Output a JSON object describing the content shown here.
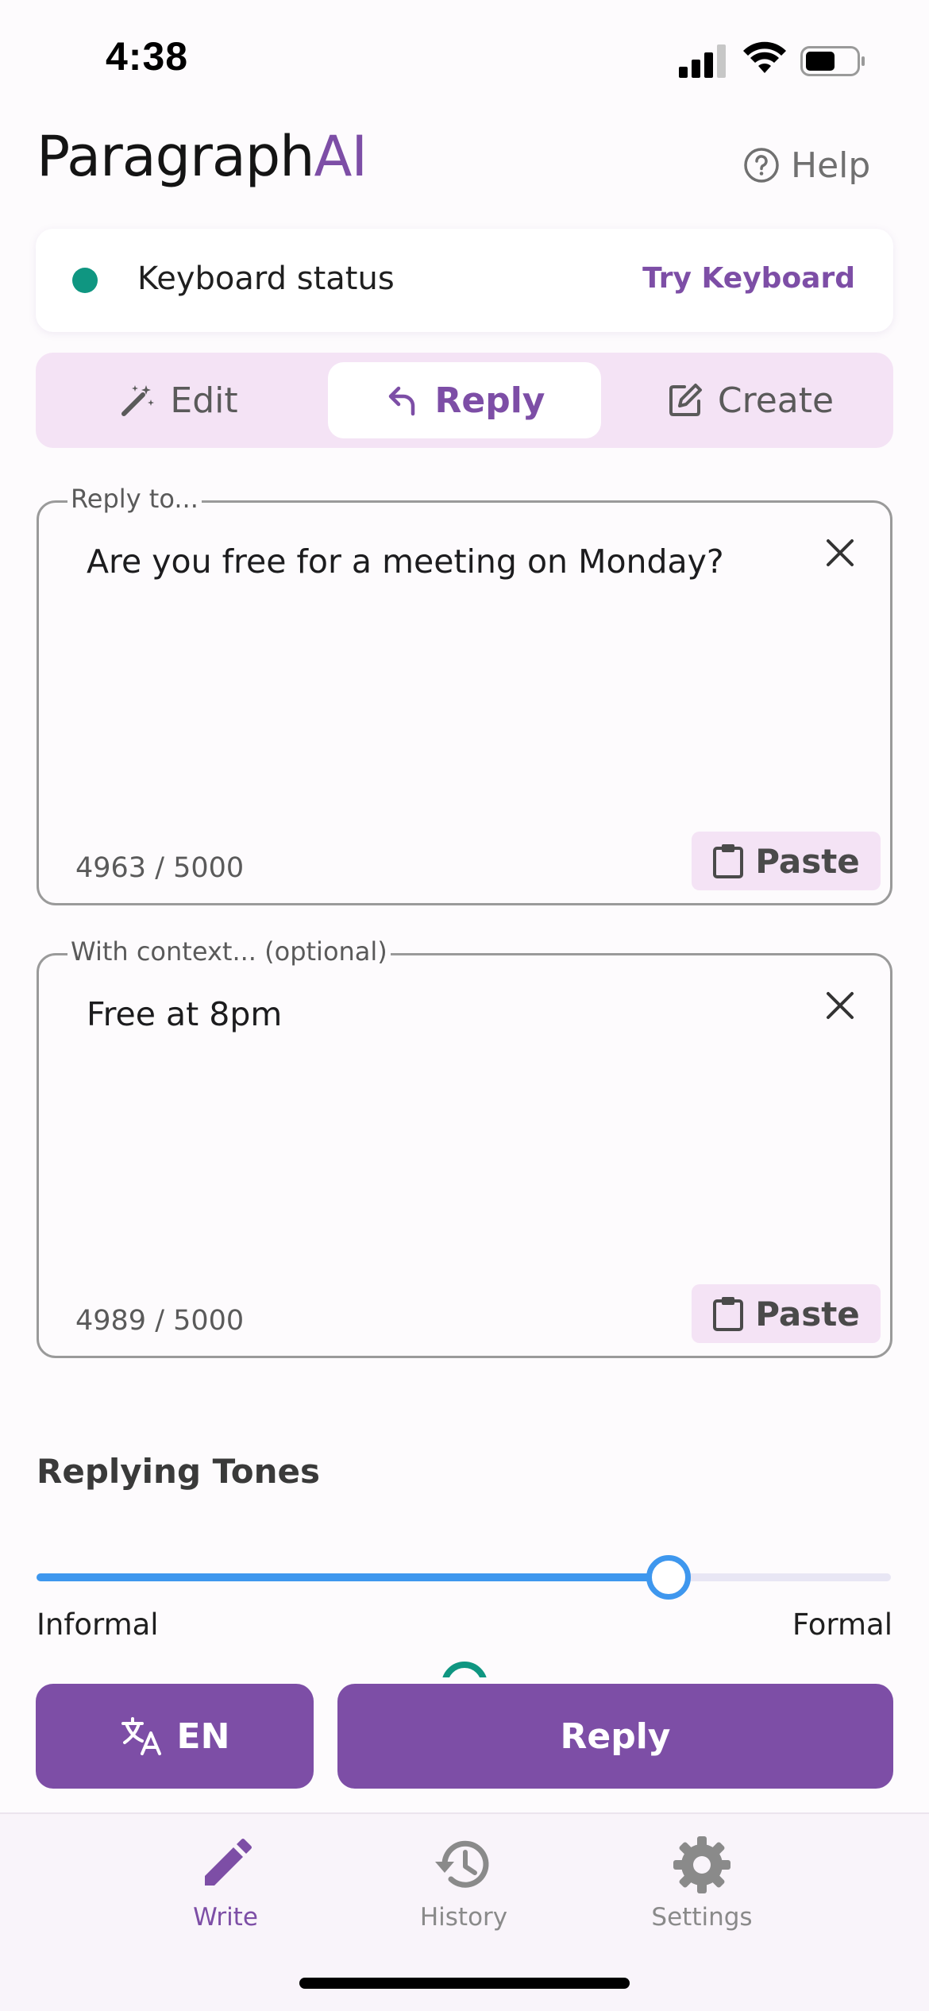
{
  "status_bar": {
    "time": "4:38"
  },
  "header": {
    "logo_main": "Paragraph",
    "logo_accent": "AI",
    "help_label": "Help"
  },
  "keyboard_status": {
    "label": "Keyboard status",
    "action": "Try Keyboard",
    "status_color": "#0f9681"
  },
  "mode_tabs": [
    {
      "label": "Edit",
      "icon": "magic-wand-icon"
    },
    {
      "label": "Reply",
      "icon": "reply-arrow-icon",
      "selected": true
    },
    {
      "label": "Create",
      "icon": "edit-square-icon"
    }
  ],
  "reply_field": {
    "legend": "Reply to...",
    "value": "Are you free for a meeting on Monday?",
    "counter": "4963 / 5000",
    "paste_label": "Paste"
  },
  "context_field": {
    "legend": "With context... (optional)",
    "value": "Free at 8pm",
    "counter": "4989 / 5000",
    "paste_label": "Paste"
  },
  "tones": {
    "title": "Replying Tones",
    "min_label": "Informal",
    "max_label": "Formal",
    "value": 0.74
  },
  "actions": {
    "language_label": "EN",
    "reply_label": "Reply"
  },
  "tab_bar": [
    {
      "label": "Write",
      "icon": "pencil-icon",
      "active": true
    },
    {
      "label": "History",
      "icon": "history-icon"
    },
    {
      "label": "Settings",
      "icon": "gear-icon"
    }
  ],
  "colors": {
    "accent": "#7d4ea6",
    "accent_light": "#f4e3f5",
    "slider": "#3e97ee"
  }
}
